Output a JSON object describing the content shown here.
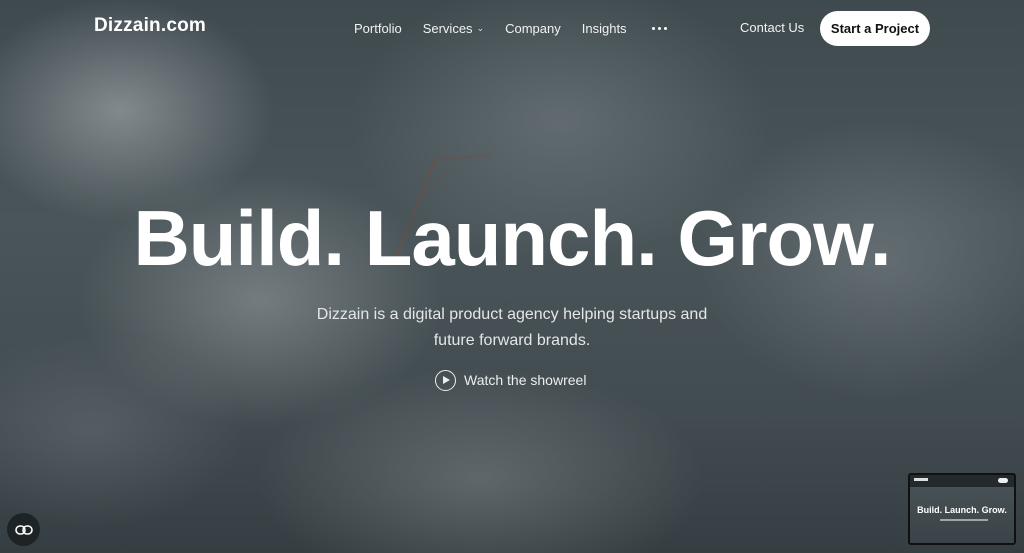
{
  "brand": {
    "logo": "Dizzain.com"
  },
  "nav": {
    "links": [
      {
        "label": "Portfolio"
      },
      {
        "label": "Services",
        "caret": "⌄"
      },
      {
        "label": "Company"
      },
      {
        "label": "Insights"
      }
    ],
    "more_icon": "more-dots-icon",
    "contact_label": "Contact Us",
    "cta_label": "Start a Project"
  },
  "hero": {
    "headline": "Build. Launch. Grow.",
    "subtitle": "Dizzain is a digital product agency helping startups and future forward brands.",
    "showreel_label": "Watch the showreel",
    "showreel_icon": "play-circle-icon"
  },
  "widgets": {
    "chat_icon": "chat-link-icon",
    "thumbnail_title": "Build. Launch. Grow."
  },
  "colors": {
    "cta_background": "#ffffff",
    "cta_text": "#111111",
    "hero_overlay": "#3f4a4f",
    "chat_button": "#1e2326"
  }
}
